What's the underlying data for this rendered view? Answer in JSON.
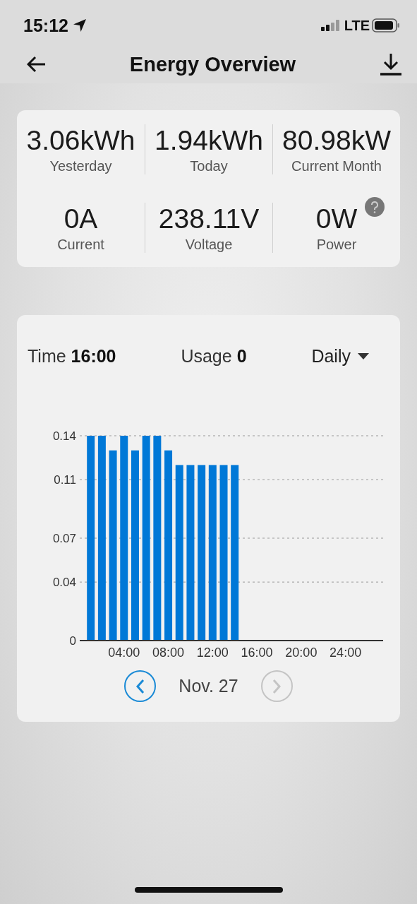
{
  "status_bar": {
    "time": "15:12",
    "network": "LTE"
  },
  "header": {
    "title": "Energy Overview"
  },
  "stats": [
    {
      "value": "3.06kWh",
      "label": "Yesterday"
    },
    {
      "value": "1.94kWh",
      "label": "Today"
    },
    {
      "value": "80.98kW",
      "label": "Current Month"
    },
    {
      "value": "0A",
      "label": "Current"
    },
    {
      "value": "238.11V",
      "label": "Voltage"
    },
    {
      "value": "0W",
      "label": "Power",
      "help": true
    }
  ],
  "usage": {
    "time": "Time **16:00**",
    "usage": "Usage **0**",
    "period": "Daily",
    "chart_data": {
      "type": "bar",
      "x": [
        1,
        2,
        3,
        4,
        5,
        6,
        7,
        8,
        9,
        10,
        11,
        12,
        13,
        14
      ],
      "grid": true,
      "series": [
        {
          "color": "#0078d7",
          "values": [
            0.14,
            0.14,
            0.13,
            0.14,
            0.13,
            0.14,
            0.14,
            0.13,
            0.12,
            0.12,
            0.12,
            0.12,
            0.12,
            0.12
          ]
        }
      ],
      "xlim": [
        0,
        27.4
      ],
      "ylim": [
        0,
        0.14
      ],
      "xticks": [
        {
          "value": 4,
          "label": "04:00"
        },
        {
          "value": 8,
          "label": "08:00"
        },
        {
          "value": 12,
          "label": "12:00"
        },
        {
          "value": 16,
          "label": "16:00"
        },
        {
          "value": 20,
          "label": "20:00"
        },
        {
          "value": 24,
          "label": "24:00"
        }
      ],
      "yticks": [
        0,
        0.04,
        0.07,
        0.11,
        0.14
      ]
    },
    "date": "Nov. 27",
    "prev": {
      "disabled": false
    },
    "next": {
      "disabled": true
    }
  }
}
